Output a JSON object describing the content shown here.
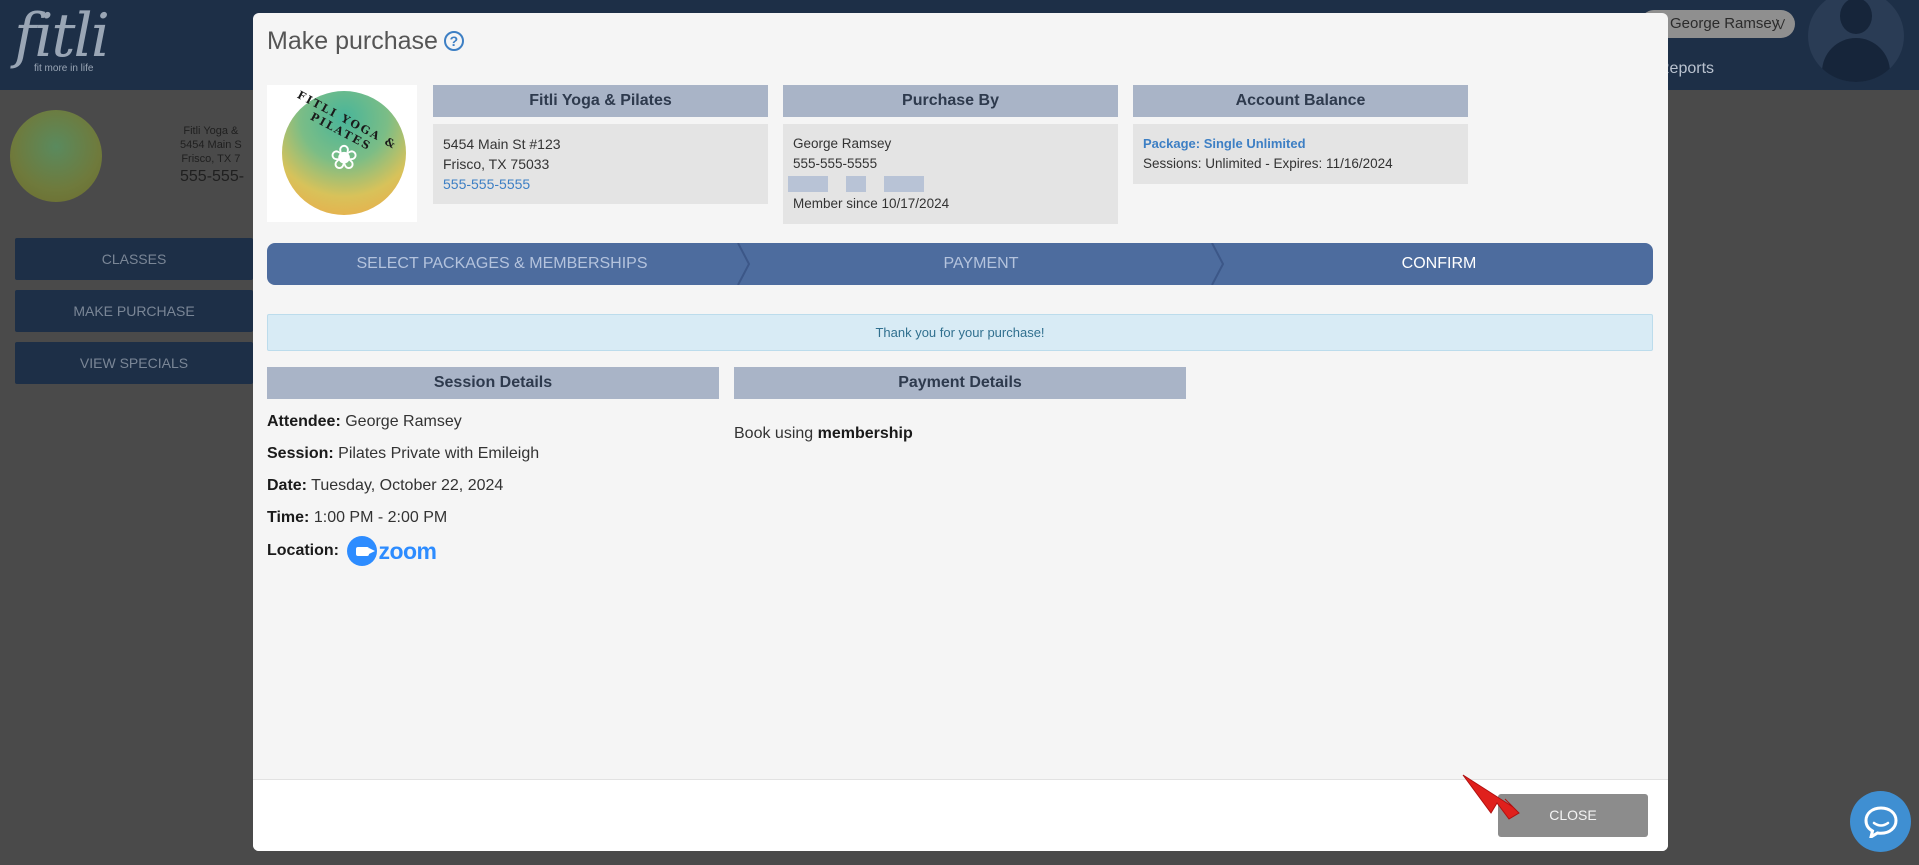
{
  "background": {
    "logo": "fitli",
    "logo_tagline": "fit more in life",
    "user_name": "George Ramsey",
    "reports_label": "Reports",
    "studio_info_lines": [
      "Fitli Yoga &",
      "5454 Main S",
      "Frisco, TX 7"
    ],
    "studio_phone": "555-555-",
    "nav": [
      "CLASSES",
      "MAKE PURCHASE",
      "VIEW SPECIALS"
    ]
  },
  "modal": {
    "title": "Make purchase",
    "studio_logo_text": "FITLI YOGA & PILATES",
    "studio_card": {
      "header": "Fitli Yoga & Pilates",
      "address_line1": "5454 Main St #123",
      "address_line2": "Frisco, TX 75033",
      "phone": "555-555-5555"
    },
    "purchase_by": {
      "header": "Purchase By",
      "name": "George Ramsey",
      "phone": "555-555-5555",
      "member_since": "Member since 10/17/2024"
    },
    "account_balance": {
      "header": "Account Balance",
      "package": "Package: Single Unlimited",
      "sessions": "Sessions: Unlimited - Expires: 11/16/2024"
    },
    "steps": [
      "SELECT PACKAGES & MEMBERSHIPS",
      "PAYMENT",
      "CONFIRM"
    ],
    "active_step": "CONFIRM",
    "alert": "Thank you for your purchase!",
    "session_details": {
      "header": "Session Details",
      "attendee_label": "Attendee:",
      "attendee": "George Ramsey",
      "session_label": "Session:",
      "session": "Pilates Private with Emileigh",
      "date_label": "Date:",
      "date": "Tuesday, October 22, 2024",
      "time_label": "Time:",
      "time": "1:00 PM - 2:00 PM",
      "location_label": "Location:",
      "location_logo": "zoom"
    },
    "payment_details": {
      "header": "Payment Details",
      "prefix": "Book using",
      "method": "membership"
    },
    "close_label": "CLOSE"
  },
  "colors": {
    "header_navy": "#1d2f47",
    "card_header": "#a9b4c7",
    "steps_bar": "#4d6c9e",
    "link_blue": "#3d7fc4",
    "zoom_blue": "#2d8cff",
    "close_button": "#8c8c8c",
    "chat_bubble": "#3f8fd2",
    "arrow_red": "#e0201c"
  },
  "icons": {
    "help": "question-circle-icon",
    "location": "zoom-camera-icon",
    "chat": "chat-bubble-icon",
    "annotation": "red-arrow-icon"
  }
}
